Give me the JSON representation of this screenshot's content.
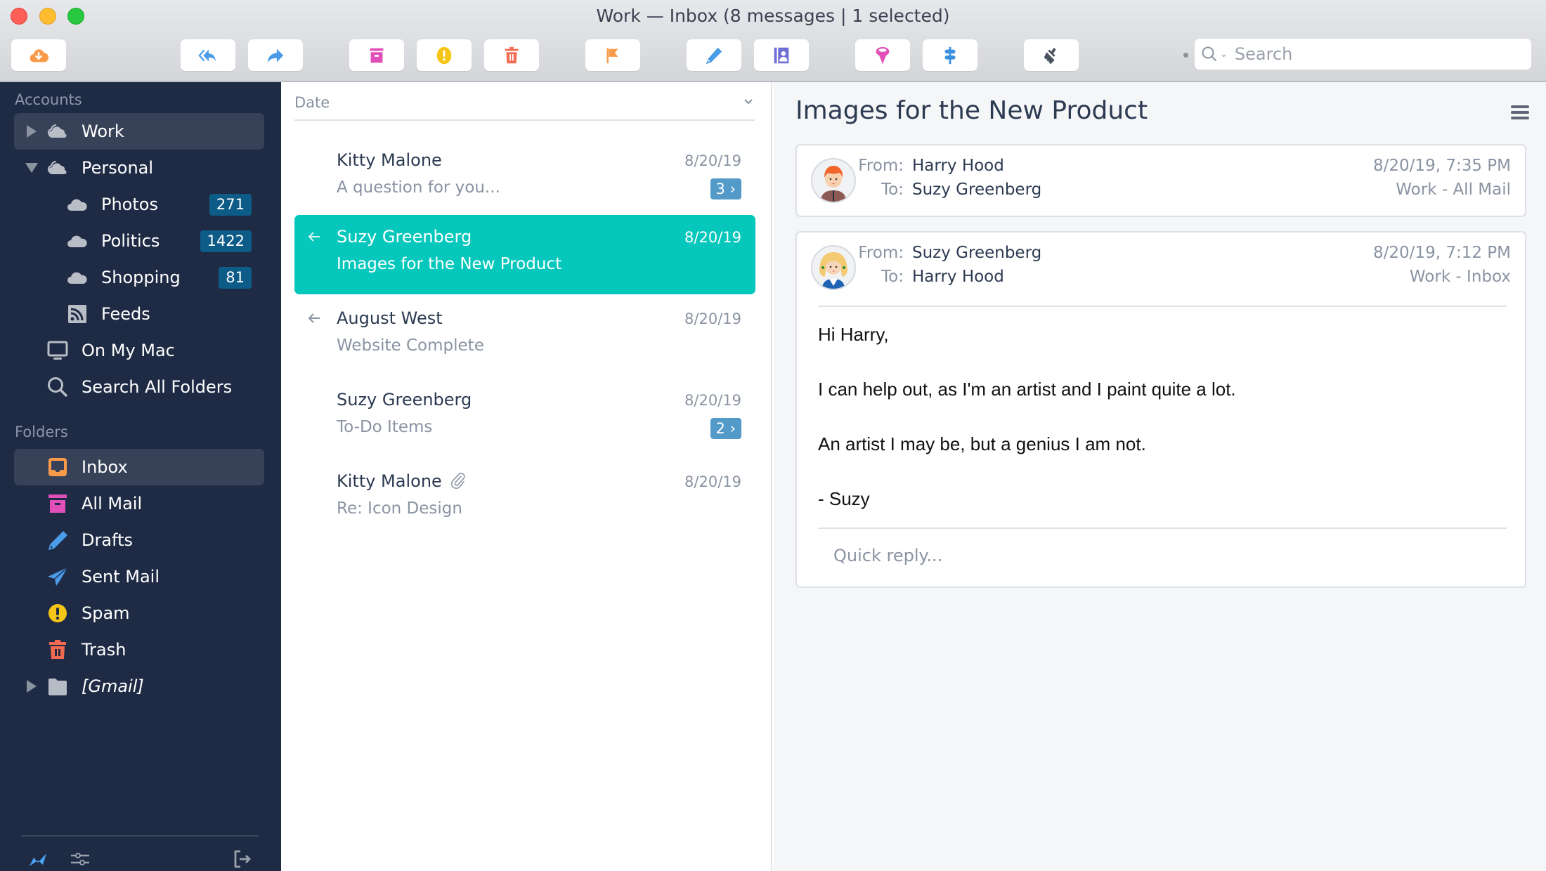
{
  "window": {
    "title": "Work — Inbox (8 messages | 1 selected)"
  },
  "toolbar": {
    "buttons": [
      {
        "name": "get-mail",
        "icon": "cloud-download-icon",
        "color": "#f99a4a"
      },
      {
        "name": "reply-all",
        "icon": "reply-all-icon",
        "color": "#4a9be8"
      },
      {
        "name": "forward",
        "icon": "forward-icon",
        "color": "#4a9be8"
      },
      {
        "name": "archive",
        "icon": "archive-icon",
        "color": "#e14fb8"
      },
      {
        "name": "spam",
        "icon": "exclamation-icon",
        "color": "#f5c518"
      },
      {
        "name": "delete",
        "icon": "trash-icon",
        "color": "#f26a4f"
      },
      {
        "name": "flag",
        "icon": "flag-icon",
        "color": "#f99a4a"
      },
      {
        "name": "compose",
        "icon": "pencil-icon",
        "color": "#4a9be8"
      },
      {
        "name": "contacts",
        "icon": "address-book-icon",
        "color": "#6f6fd8"
      },
      {
        "name": "filter",
        "icon": "funnel-icon",
        "color": "#e14fb8"
      },
      {
        "name": "rules",
        "icon": "signpost-icon",
        "color": "#3a8fe0"
      },
      {
        "name": "customize",
        "icon": "brush-icon",
        "color": "#4a5260"
      }
    ],
    "search": {
      "placeholder": "Search",
      "value": ""
    }
  },
  "sidebar": {
    "accounts_header": "Accounts",
    "accounts": [
      {
        "label": "Work",
        "icon": "cloud-account-icon",
        "disclosure": "collapsed",
        "selected": true
      },
      {
        "label": "Personal",
        "icon": "cloud-account-icon",
        "disclosure": "expanded",
        "selected": false
      },
      {
        "label": "Photos",
        "icon": "cloud-icon",
        "badge": "271"
      },
      {
        "label": "Politics",
        "icon": "cloud-icon",
        "badge": "1422"
      },
      {
        "label": "Shopping",
        "icon": "cloud-icon",
        "badge": "81"
      },
      {
        "label": "Feeds",
        "icon": "rss-icon"
      },
      {
        "label": "On My Mac",
        "icon": "monitor-icon"
      },
      {
        "label": "Search All Folders",
        "icon": "search-icon"
      }
    ],
    "folders_header": "Folders",
    "folders": [
      {
        "label": "Inbox",
        "icon": "inbox-icon",
        "color": "#f99a4a",
        "selected": true
      },
      {
        "label": "All Mail",
        "icon": "archive-icon",
        "color": "#e14fb8"
      },
      {
        "label": "Drafts",
        "icon": "pencil-icon",
        "color": "#4a9be8"
      },
      {
        "label": "Sent Mail",
        "icon": "paper-plane-icon",
        "color": "#4a9be8"
      },
      {
        "label": "Spam",
        "icon": "exclamation-icon",
        "color": "#f5c518"
      },
      {
        "label": "Trash",
        "icon": "trash-icon",
        "color": "#f26a4f"
      },
      {
        "label": "[Gmail]",
        "icon": "folder-icon",
        "color": "#b6bcc6",
        "disclosure": "collapsed"
      }
    ],
    "footer": {
      "activity_icon": "activity-icon",
      "settings_icon": "sliders-icon",
      "logout_icon": "sign-out-icon"
    }
  },
  "message_list": {
    "sort_label": "Date",
    "messages": [
      {
        "sender": "Kitty Malone",
        "subject": "A question for you...",
        "date": "8/20/19",
        "thread_count": "3",
        "replied": false,
        "attachment": false,
        "selected": false
      },
      {
        "sender": "Suzy Greenberg",
        "subject": "Images for the New Product",
        "date": "8/20/19",
        "replied": true,
        "attachment": false,
        "selected": true
      },
      {
        "sender": "August West",
        "subject": "Website Complete",
        "date": "8/20/19",
        "replied": true,
        "attachment": false,
        "selected": false
      },
      {
        "sender": "Suzy Greenberg",
        "subject": "To-Do Items",
        "date": "8/20/19",
        "thread_count": "2",
        "replied": false,
        "attachment": false,
        "selected": false
      },
      {
        "sender": "Kitty Malone",
        "subject": "Re: Icon Design",
        "date": "8/20/19",
        "replied": false,
        "attachment": true,
        "selected": false
      }
    ]
  },
  "reader": {
    "subject": "Images for the New Product",
    "from_label": "From:",
    "to_label": "To:",
    "messages": [
      {
        "from": "Harry Hood",
        "to": "Suzy Greenberg",
        "datetime": "8/20/19, 7:35 PM",
        "mailbox": "Work - All Mail",
        "avatar": "male-avatar",
        "collapsed": true
      },
      {
        "from": "Suzy Greenberg",
        "to": "Harry Hood",
        "datetime": "8/20/19, 7:12 PM",
        "mailbox": "Work - Inbox",
        "avatar": "female-avatar",
        "collapsed": false,
        "body": [
          "Hi Harry,",
          "I can help out, as I'm an artist and I paint quite a lot.",
          "An artist I may be, but a genius I am not.",
          "- Suzy"
        ]
      }
    ],
    "quick_reply_placeholder": "Quick reply..."
  },
  "colors": {
    "sidebar_bg": "#1f2b45",
    "sidebar_selected": "#374259",
    "badge_bg": "#0d5b87",
    "selection_teal": "#05c7bb",
    "thread_badge": "#539ac9"
  }
}
